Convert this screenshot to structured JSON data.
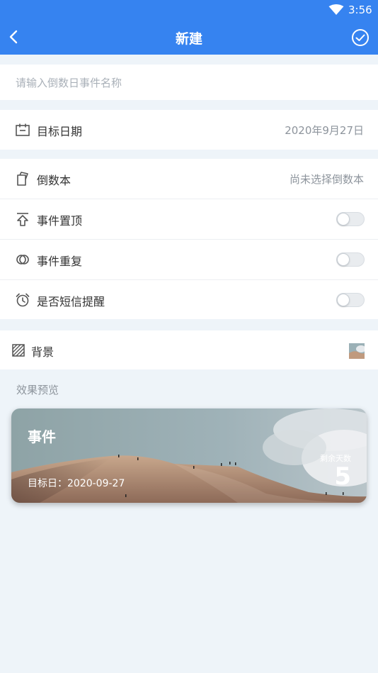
{
  "status_bar": {
    "time": "3:56"
  },
  "app_bar": {
    "title": "新建"
  },
  "name_input": {
    "placeholder": "请输入倒数日事件名称",
    "value": ""
  },
  "target_date": {
    "label": "目标日期",
    "value": "2020年9月27日"
  },
  "book": {
    "label": "倒数本",
    "value": "尚未选择倒数本"
  },
  "pin": {
    "label": "事件置顶",
    "on": false
  },
  "repeat": {
    "label": "事件重复",
    "on": false
  },
  "sms": {
    "label": "是否短信提醒",
    "on": false
  },
  "background": {
    "label": "背景"
  },
  "preview": {
    "section_label": "效果预览",
    "event_title": "事件",
    "target_text": "目标日：2020-09-27",
    "remaining_label": "剩余天数",
    "remaining_days": "5"
  },
  "colors": {
    "primary": "#3683f0",
    "page_bg": "#eef4f9"
  },
  "icons": [
    "wifi-icon",
    "back-arrow-icon",
    "check-circle-icon",
    "calendar-icon",
    "notebook-icon",
    "pin-top-icon",
    "repeat-icon",
    "alarm-clock-icon",
    "background-pattern-icon"
  ]
}
